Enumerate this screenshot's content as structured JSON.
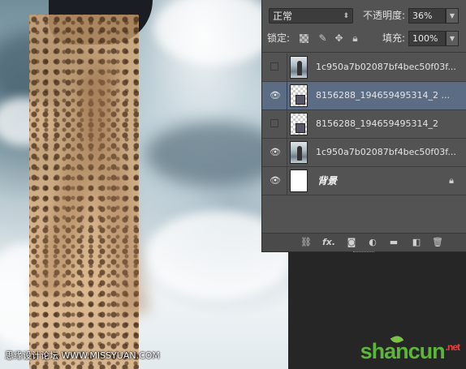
{
  "layers_panel": {
    "blend_mode": "正常",
    "opacity_label": "不透明度:",
    "opacity_value": "36%",
    "lock_label": "锁定:",
    "fill_label": "填充:",
    "fill_value": "100%",
    "layers": [
      {
        "name": "1c950a7b02087bf4bec50f03f...",
        "visible": false,
        "selected": false,
        "thumb": "photo"
      },
      {
        "name": "8156288_194659495314_2 ...",
        "visible": true,
        "selected": true,
        "thumb": "checker"
      },
      {
        "name": "8156288_194659495314_2",
        "visible": false,
        "selected": false,
        "thumb": "checker"
      },
      {
        "name": "1c950a7b02087bf4bec50f03f...",
        "visible": true,
        "selected": false,
        "thumb": "photo"
      },
      {
        "name": "背景",
        "visible": true,
        "selected": false,
        "thumb": "white",
        "locked": true
      }
    ],
    "bottom_icons": [
      "link-layers-icon",
      "fx-icon",
      "add-mask-icon",
      "adjustment-layer-icon",
      "new-group-icon",
      "new-layer-icon",
      "delete-layer-icon"
    ]
  },
  "canvas": {
    "watermark": "思缘设计论坛 WWW.MISSYUAN.COM"
  },
  "branding": {
    "site_logo": "shancun",
    "site_suffix": ".net"
  },
  "colors": {
    "panel_bg": "#535353",
    "selected_row": "#5c6c85",
    "brand_green": "#5bb63a"
  }
}
